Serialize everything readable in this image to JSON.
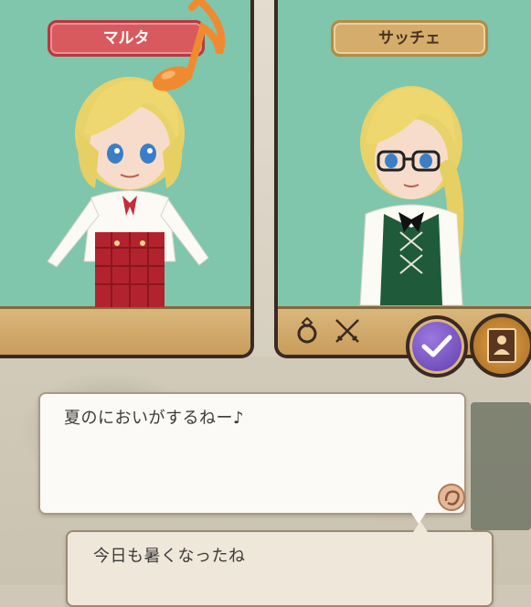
{
  "characters": {
    "left": {
      "name": "マルタ"
    },
    "right": {
      "name": "サッチェ"
    }
  },
  "icons": {
    "music": "music-note-icon",
    "ring": "ring-icon",
    "swords": "crossed-swords-icon",
    "confirm": "checkmark-icon",
    "profile": "profile-card-icon",
    "next": "next-arrow-icon"
  },
  "dialogue": {
    "line1": "夏のにおいがするねー♪",
    "line2": "今日も暑くなったね"
  },
  "colors": {
    "panel_bg": "#7fc6ad",
    "left_plate": "#d85a5e",
    "right_plate": "#d4ad6c",
    "confirm_button": "#6f4cbc"
  }
}
